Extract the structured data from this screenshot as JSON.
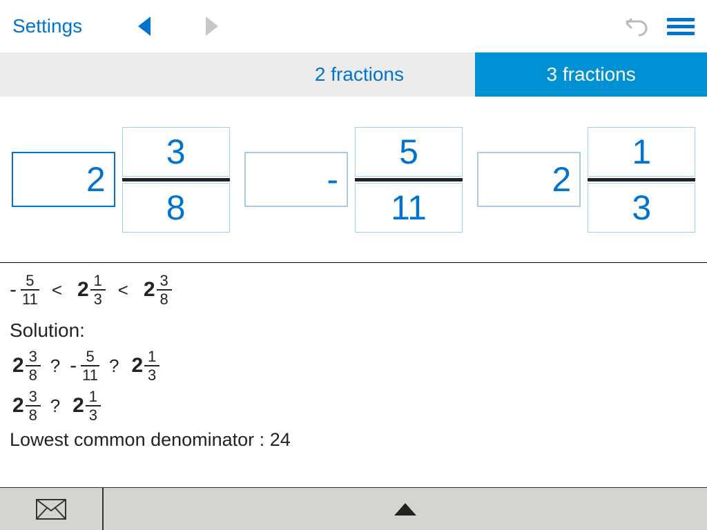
{
  "header": {
    "settings_label": "Settings"
  },
  "tabs": {
    "two_label": "2 fractions",
    "three_label": "3 fractions"
  },
  "inputs": {
    "f1": {
      "whole": "2",
      "num": "3",
      "den": "8"
    },
    "f2": {
      "whole": "-",
      "num": "5",
      "den": "11"
    },
    "f3": {
      "whole": "2",
      "num": "1",
      "den": "3"
    }
  },
  "result_row": {
    "t1": {
      "sign": "-",
      "whole": "",
      "num": "5",
      "den": "11"
    },
    "cmp1": "<",
    "t2": {
      "sign": "",
      "whole": "2",
      "num": "1",
      "den": "3"
    },
    "cmp2": "<",
    "t3": {
      "sign": "",
      "whole": "2",
      "num": "3",
      "den": "8"
    }
  },
  "solution": {
    "label": "Solution:",
    "line1": {
      "a": {
        "sign": "",
        "whole": "2",
        "num": "3",
        "den": "8"
      },
      "op1": "?",
      "b": {
        "sign": "-",
        "whole": "",
        "num": "5",
        "den": "11"
      },
      "op2": "?",
      "c": {
        "sign": "",
        "whole": "2",
        "num": "1",
        "den": "3"
      }
    },
    "line2": {
      "a": {
        "sign": "",
        "whole": "2",
        "num": "3",
        "den": "8"
      },
      "op1": "?",
      "b": {
        "sign": "",
        "whole": "2",
        "num": "1",
        "den": "3"
      }
    },
    "lcd_label": "Lowest common denominator : ",
    "lcd_value": "24"
  }
}
